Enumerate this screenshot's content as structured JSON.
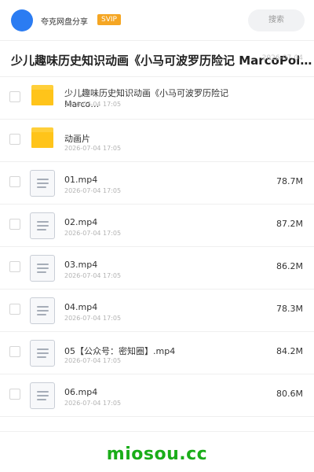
{
  "header": {
    "app_name": "夸克网盘分享",
    "badge": "SVIP",
    "search_label": "搜索",
    "avatar_color": "#2b7cf2",
    "badge_color": "#f5a623"
  },
  "title": {
    "text": "少儿趣味历史知识动画《小马可波罗历险记 MarcoPolo(…",
    "meta": "2026-07-04"
  },
  "items": [
    {
      "type": "folder",
      "icon": "folder-icon",
      "name": "少儿趣味历史知识动画《小马可波罗历险记 Marco…",
      "date": "2026-07-04 17:05",
      "size": ""
    },
    {
      "type": "folder",
      "icon": "folder-icon",
      "name": "动画片",
      "date": "2026-07-04 17:05",
      "size": ""
    },
    {
      "type": "file",
      "icon": "document-icon",
      "name": "01.mp4",
      "date": "2026-07-04 17:05",
      "size": "78.7M"
    },
    {
      "type": "file",
      "icon": "document-icon",
      "name": "02.mp4",
      "date": "2026-07-04 17:05",
      "size": "87.2M"
    },
    {
      "type": "file",
      "icon": "document-icon",
      "name": "03.mp4",
      "date": "2026-07-04 17:05",
      "size": "86.2M"
    },
    {
      "type": "file",
      "icon": "document-icon",
      "name": "04.mp4",
      "date": "2026-07-04 17:05",
      "size": "78.3M"
    },
    {
      "type": "file",
      "icon": "document-icon",
      "name": "05【公众号：密知圈】.mp4",
      "date": "2026-07-04 17:05",
      "size": "84.2M"
    },
    {
      "type": "file",
      "icon": "document-icon",
      "name": "06.mp4",
      "date": "2026-07-04 17:05",
      "size": "80.6M"
    }
  ],
  "footer": {
    "brand": "miosou.cc",
    "brand_color": "#1aad19"
  }
}
